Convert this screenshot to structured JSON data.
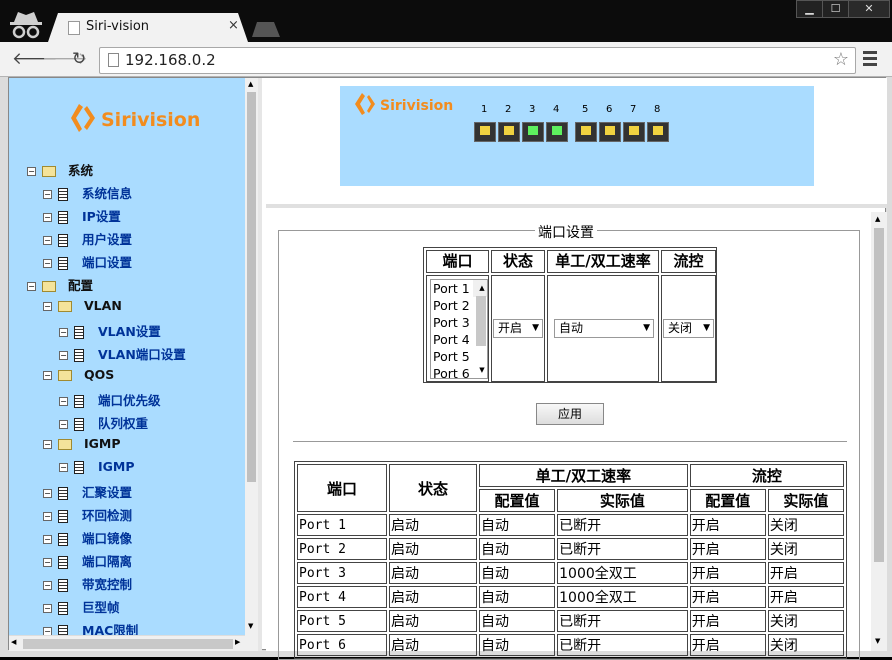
{
  "browser": {
    "tab_title": "Siri-vision",
    "tab_close": "×",
    "url": "192.168.0.2"
  },
  "sidebar": {
    "logo_text": "Sirivision",
    "items": [
      {
        "label": "系统",
        "type": "folder"
      },
      {
        "label": "系统信息",
        "type": "page"
      },
      {
        "label": "IP设置",
        "type": "page"
      },
      {
        "label": "用户设置",
        "type": "page"
      },
      {
        "label": "端口设置",
        "type": "page"
      },
      {
        "label": "配置",
        "type": "folder"
      },
      {
        "label": "VLAN",
        "type": "folder"
      },
      {
        "label": "VLAN设置",
        "type": "page"
      },
      {
        "label": "VLAN端口设置",
        "type": "page"
      },
      {
        "label": "QOS",
        "type": "folder"
      },
      {
        "label": "端口优先级",
        "type": "page"
      },
      {
        "label": "队列权重",
        "type": "page"
      },
      {
        "label": "IGMP",
        "type": "folder"
      },
      {
        "label": "IGMP",
        "type": "page"
      },
      {
        "label": "汇聚设置",
        "type": "page"
      },
      {
        "label": "环回检测",
        "type": "page"
      },
      {
        "label": "端口镜像",
        "type": "page"
      },
      {
        "label": "端口隔离",
        "type": "page"
      },
      {
        "label": "带宽控制",
        "type": "page"
      },
      {
        "label": "巨型帧",
        "type": "page"
      },
      {
        "label": "MAC限制",
        "type": "page"
      }
    ]
  },
  "banner": {
    "logo_text": "Sirivision",
    "ports": [
      {
        "num": "1",
        "link": false
      },
      {
        "num": "2",
        "link": false
      },
      {
        "num": "3",
        "link": true
      },
      {
        "num": "4",
        "link": true
      },
      {
        "num": "5",
        "link": false
      },
      {
        "num": "6",
        "link": false
      },
      {
        "num": "7",
        "link": false
      },
      {
        "num": "8",
        "link": false
      }
    ]
  },
  "port_settings": {
    "legend": "端口设置",
    "headers": {
      "port": "端口",
      "state": "状态",
      "speed": "单工/双工速率",
      "flow": "流控"
    },
    "port_options": [
      "Port 1",
      "Port 2",
      "Port 3",
      "Port 4",
      "Port 5",
      "Port 6"
    ],
    "state_value": "开启",
    "speed_value": "自动",
    "flow_value": "关闭",
    "apply_label": "应用"
  },
  "status_table": {
    "headers": {
      "port": "端口",
      "state": "状态",
      "speed": "单工/双工速率",
      "flow": "流控",
      "config": "配置值",
      "actual": "实际值"
    },
    "rows": [
      [
        "Port 1",
        "启动",
        "自动",
        "已断开",
        "开启",
        "关闭"
      ],
      [
        "Port 2",
        "启动",
        "自动",
        "已断开",
        "开启",
        "关闭"
      ],
      [
        "Port 3",
        "启动",
        "自动",
        "1000全双工",
        "开启",
        "开启"
      ],
      [
        "Port 4",
        "启动",
        "自动",
        "1000全双工",
        "开启",
        "开启"
      ],
      [
        "Port 5",
        "启动",
        "自动",
        "已断开",
        "开启",
        "关闭"
      ],
      [
        "Port 6",
        "启动",
        "自动",
        "已断开",
        "开启",
        "关闭"
      ]
    ]
  }
}
